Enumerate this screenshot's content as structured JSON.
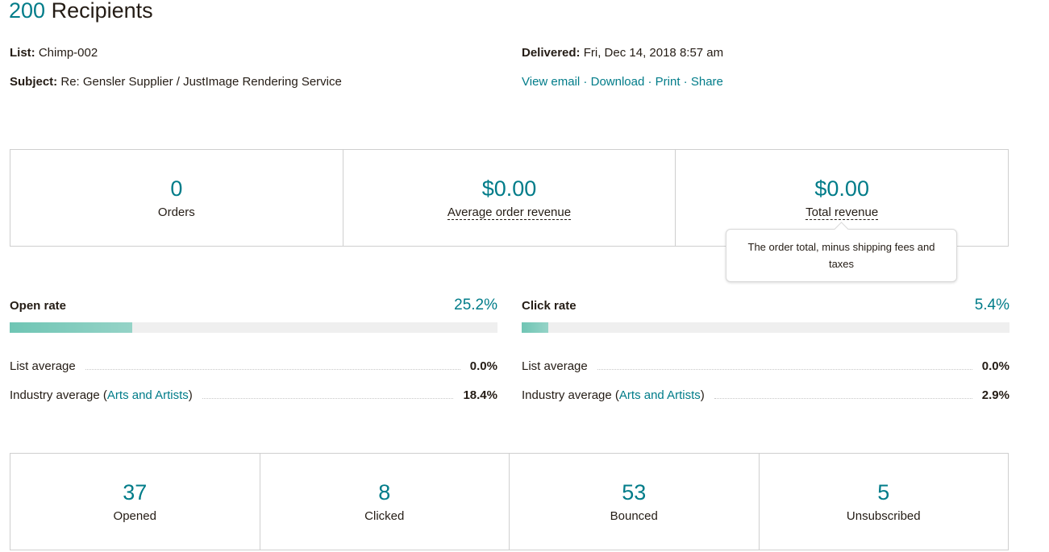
{
  "header": {
    "count": "200",
    "title_suffix": " Recipients"
  },
  "meta": {
    "list_label": "List:",
    "list_value": " Chimp-002",
    "subject_label": "Subject:",
    "subject_value": " Re: Gensler Supplier / JustImage Rendering Service",
    "delivered_label": "Delivered:",
    "delivered_value": " Fri, Dec 14, 2018 8:57 am",
    "links": [
      "View email",
      "Download",
      "Print",
      "Share"
    ],
    "separator": " · "
  },
  "revenue": [
    {
      "value": "0",
      "label": "Orders"
    },
    {
      "value": "$0.00",
      "label": "Average order revenue"
    },
    {
      "value": "$0.00",
      "label": "Total revenue"
    }
  ],
  "tooltip": {
    "text": "The order total, minus shipping fees and taxes"
  },
  "open_rate": {
    "label": "Open rate",
    "value": "25.2%",
    "fill_fraction": 0.252,
    "list_avg_label": "List average",
    "list_avg_value": "0.0%",
    "industry_label_prefix": "Industry average (",
    "industry_link": "Arts and Artists",
    "industry_label_suffix": ")",
    "industry_value": "18.4%"
  },
  "click_rate": {
    "label": "Click rate",
    "value": "5.4%",
    "fill_fraction": 0.054,
    "list_avg_label": "List average",
    "list_avg_value": "0.0%",
    "industry_label_prefix": "Industry average (",
    "industry_link": "Arts and Artists",
    "industry_label_suffix": ")",
    "industry_value": "2.9%"
  },
  "stats": [
    {
      "value": "37",
      "label": "Opened"
    },
    {
      "value": "8",
      "label": "Clicked"
    },
    {
      "value": "53",
      "label": "Bounced"
    },
    {
      "value": "5",
      "label": "Unsubscribed"
    }
  ],
  "colors": {
    "accent": "#007c89",
    "bar_fill": "#6fc5b4",
    "bar_track": "#efefef"
  }
}
